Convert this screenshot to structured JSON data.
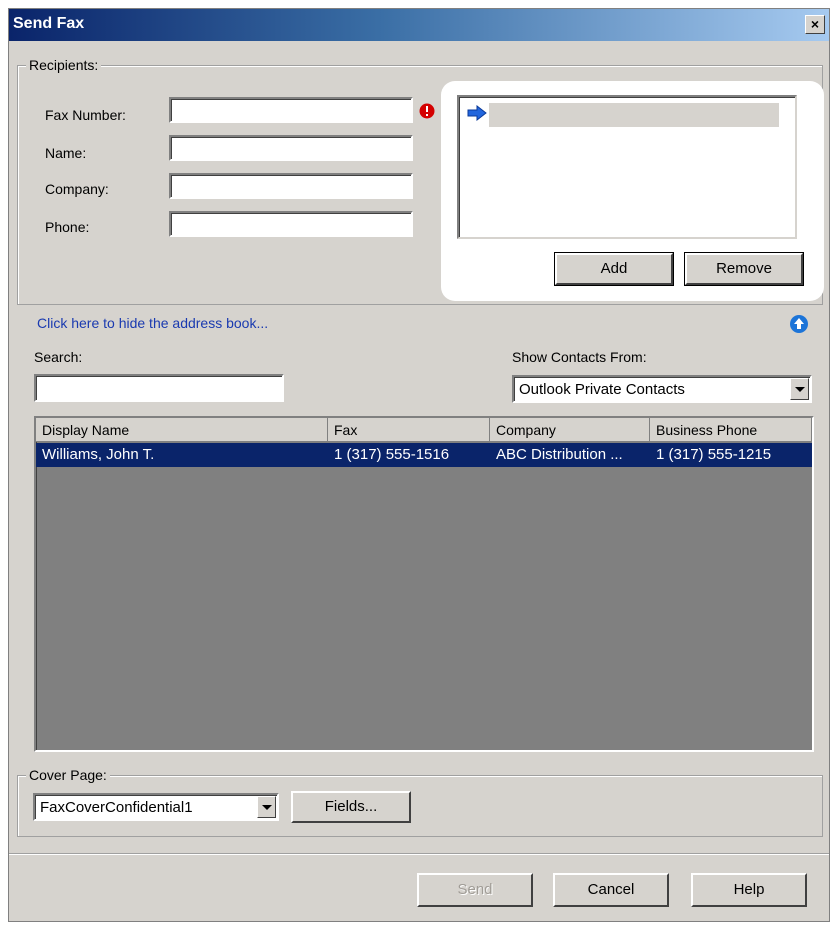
{
  "window": {
    "title": "Send Fax",
    "close_glyph": "×"
  },
  "recipients": {
    "group_label": "Recipients:",
    "fax_number_label": "Fax Number:",
    "name_label": "Name:",
    "company_label": "Company:",
    "phone_label": "Phone:",
    "fax_number_value": "",
    "name_value": "",
    "company_value": "",
    "phone_value": "",
    "add_label": "Add",
    "remove_label": "Remove"
  },
  "address_book": {
    "hide_link": "Click here to hide the address book...",
    "search_label": "Search:",
    "search_value": "",
    "show_contacts_label": "Show Contacts From:",
    "show_contacts_selected": "Outlook Private Contacts",
    "columns": [
      "Display Name",
      "Fax",
      "Company",
      "Business Phone"
    ],
    "rows": [
      {
        "display_name": "Williams, John T.",
        "fax": "1 (317) 555-1516",
        "company": "ABC Distribution ...",
        "business_phone": "1 (317) 555-1215"
      }
    ]
  },
  "cover_page": {
    "group_label": "Cover Page:",
    "selected": "FaxCoverConfidential1",
    "fields_label": "Fields..."
  },
  "footer": {
    "send_label": "Send",
    "cancel_label": "Cancel",
    "help_label": "Help"
  },
  "colors": {
    "selection": "#0a246a",
    "error_icon": "#d40000",
    "link": "#1a3ab0",
    "arrow_icon": "#2266dd"
  }
}
